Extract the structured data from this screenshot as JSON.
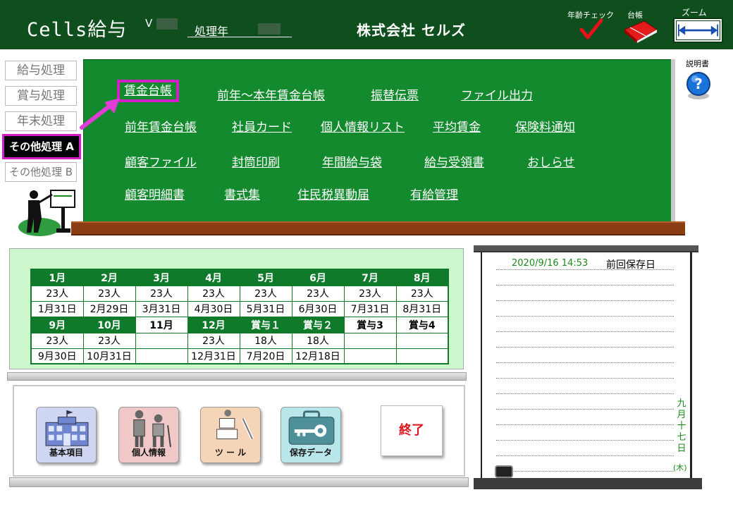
{
  "header": {
    "app_title": "Cells給与",
    "version_prefix": "V",
    "year_label": "処理年",
    "company": "株式会社  セルズ",
    "age_check_label": "年齢チェック",
    "ledger_label": "台帳",
    "zoom_label": "ズーム",
    "manual_label": "説明書"
  },
  "sidebar": {
    "items": [
      {
        "label": "給与処理"
      },
      {
        "label": "賞与処理"
      },
      {
        "label": "年末処理"
      },
      {
        "label": "その他処理 A"
      },
      {
        "label": "その他処理 B"
      }
    ]
  },
  "board": {
    "rows": [
      [
        "賃金台帳",
        "前年～本年賃金台帳",
        "振替伝票",
        "ファイル出力"
      ],
      [
        "前年賃金台帳",
        "社員カード",
        "個人情報リスト",
        "平均賃金",
        "保険料通知"
      ],
      [
        "顧客ファイル",
        "封筒印刷",
        "年間給与袋",
        "給与受領書",
        "おしらせ"
      ],
      [
        "顧客明細書",
        "書式集",
        "住民税異動届",
        "有給管理"
      ]
    ]
  },
  "calendar": {
    "row1_heads": [
      "1月",
      "2月",
      "3月",
      "4月",
      "5月",
      "6月",
      "7月",
      "8月"
    ],
    "row1_counts": [
      "23人",
      "23人",
      "23人",
      "23人",
      "23人",
      "23人",
      "23人",
      "23人"
    ],
    "row1_dates": [
      "1月31日",
      "2月29日",
      "3月31日",
      "4月30日",
      "5月31日",
      "6月30日",
      "7月31日",
      "8月31日"
    ],
    "row2_heads": [
      "9月",
      "10月",
      "11月",
      "12月",
      "賞与１",
      "賞与２",
      "賞与3",
      "賞与4"
    ],
    "row2_counts": [
      "23人",
      "23人",
      "",
      "23人",
      "18人",
      "18人",
      "",
      ""
    ],
    "row2_dates": [
      "9月30日",
      "10月31日",
      "",
      "12月31日",
      "7月20日",
      "12月18日",
      "",
      ""
    ]
  },
  "tools": {
    "basic": "基本項目",
    "personal": "個人情報",
    "tool": "ツ ー ル",
    "save": "保存データ",
    "exit": "終了"
  },
  "notepad": {
    "last_saved_time": "2020/9/16 14:53",
    "last_saved_label": "前回保存日",
    "date_vertical": "九月十七日",
    "day_of_week": "(木)"
  },
  "colors": {
    "header_bg": "#0f4f1e",
    "board_bg": "#138a2e",
    "highlight": "#d41fc8",
    "calendar_bg": "#cdf7cd",
    "exit_red": "#e0141e"
  }
}
